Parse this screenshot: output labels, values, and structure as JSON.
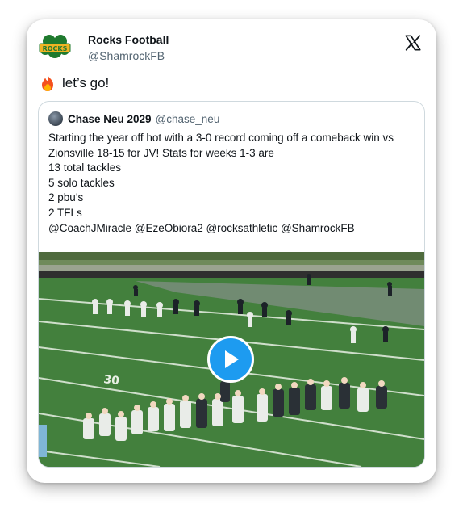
{
  "author": {
    "name": "Rocks Football",
    "handle": "@ShamrockFB",
    "logo_text": "ROCKS"
  },
  "platform_icon": "x-logo-icon",
  "tweet": {
    "emoji": "fire-emoji",
    "text": "let’s go!"
  },
  "quoted_tweet": {
    "author_name": "Chase Neu 2029",
    "author_handle": "@chase_neu",
    "lines": [
      "Starting the year off hot with a 3-0 record coming off a comeback win vs",
      "Zionsville 18-15 for JV! Stats for weeks 1-3 are",
      "13 total tackles",
      "5 solo tackles",
      "2 pbu’s",
      "2 TFLs",
      "@CoachJMiracle @EzeObiora2 @rocksathletic @ShamrockFB"
    ],
    "media": {
      "type": "video",
      "play_icon": "play-icon",
      "field_marking": "30"
    }
  },
  "colors": {
    "play_button": "#1d9bf0",
    "logo_green": "#1f7a2e",
    "logo_gold": "#f0b323",
    "turf": "#3f7a3a"
  }
}
